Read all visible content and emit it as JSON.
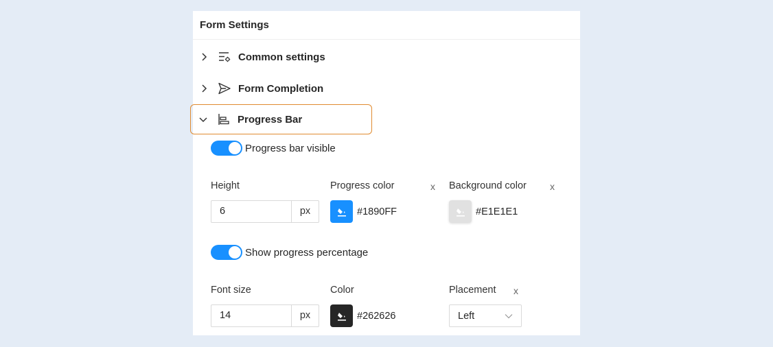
{
  "panel": {
    "title": "Form Settings"
  },
  "sections": [
    {
      "label": "Common settings",
      "icon": "settings-list-icon",
      "expanded": false
    },
    {
      "label": "Form Completion",
      "icon": "send-icon",
      "expanded": false
    },
    {
      "label": "Progress Bar",
      "icon": "progress-bar-icon",
      "expanded": true
    }
  ],
  "progress_bar": {
    "visible_toggle": {
      "label": "Progress bar visible",
      "on": true
    },
    "height": {
      "label": "Height",
      "value": "6",
      "unit": "px"
    },
    "progress_color": {
      "label": "Progress color",
      "value": "#1890FF",
      "clear": "x"
    },
    "background_color": {
      "label": "Background color",
      "value": "#E1E1E1",
      "clear": "x"
    },
    "percentage_toggle": {
      "label": "Show progress percentage",
      "on": true
    },
    "font_size": {
      "label": "Font size",
      "value": "14",
      "unit": "px"
    },
    "color": {
      "label": "Color",
      "value": "#262626"
    },
    "placement": {
      "label": "Placement",
      "value": "Left",
      "clear": "x"
    }
  },
  "colors": {
    "accent": "#1890ff",
    "highlight_border": "#e08a2e",
    "page_bg": "#e4ecf6"
  }
}
